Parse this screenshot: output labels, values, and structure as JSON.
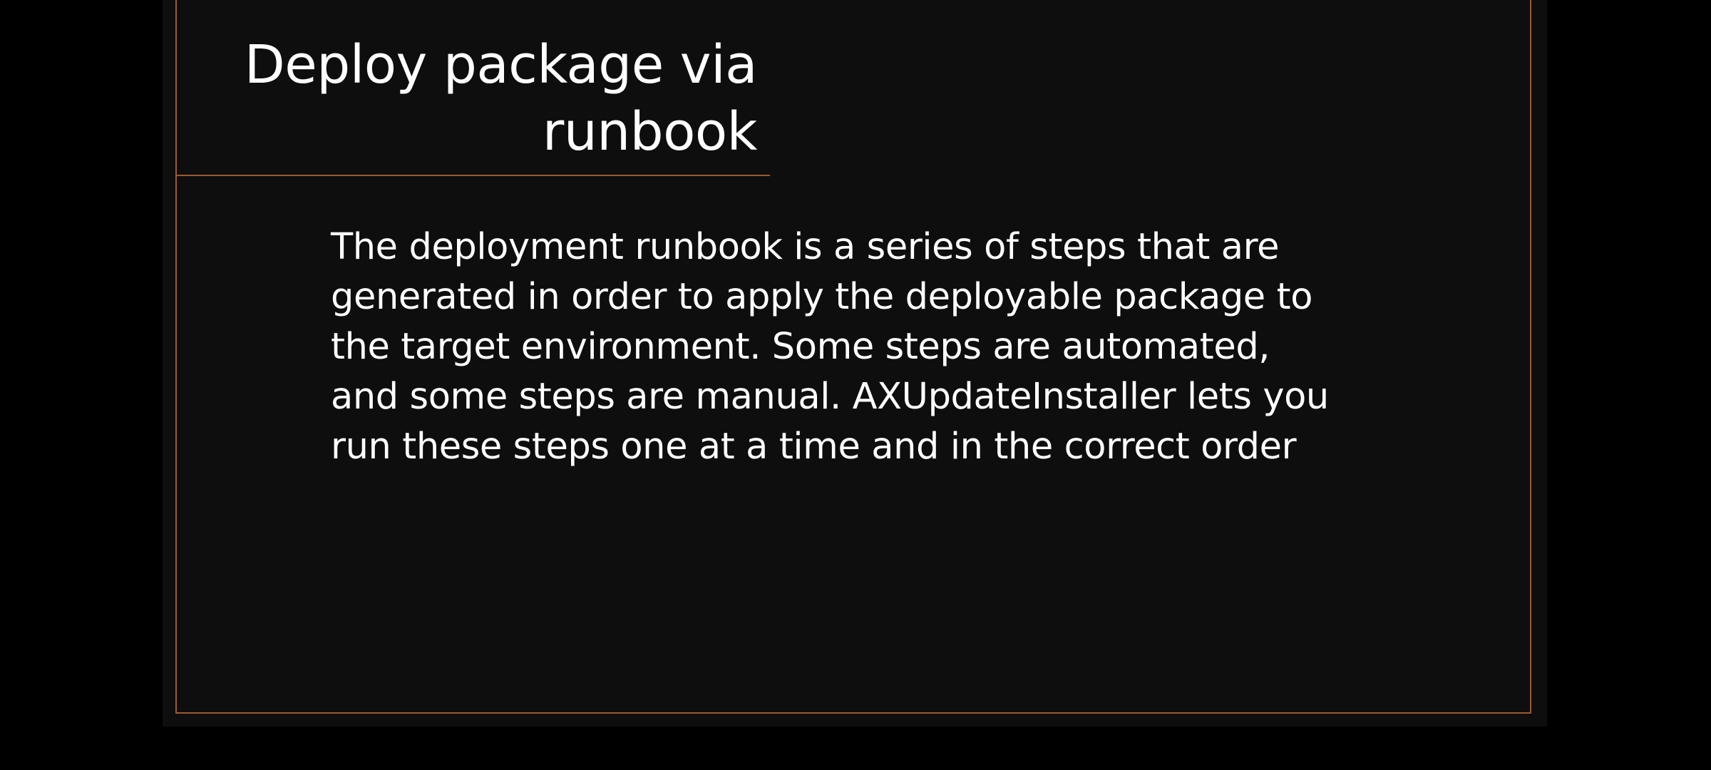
{
  "slide": {
    "title_line1": "Deploy package via",
    "title_line2": "runbook",
    "body_lines": [
      "The deployment runbook is a series of steps that are",
      "generated in order to apply the deployable package to",
      "the target environment. Some steps are automated,",
      "and some steps are manual. AXUpdateInstaller lets you",
      "run these steps one at a time and in the correct order"
    ]
  },
  "colors": {
    "background": "#000000",
    "slide_background": "#0e0e0e",
    "accent": "#9b5a30",
    "text": "#ffffff"
  }
}
